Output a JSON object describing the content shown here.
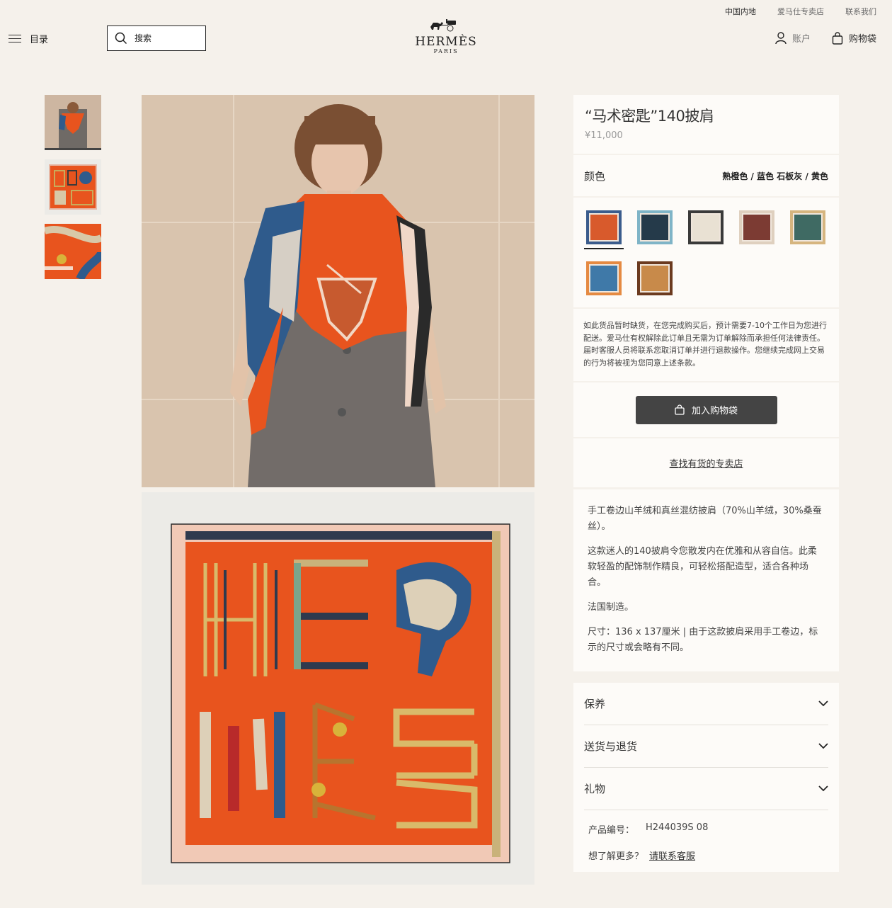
{
  "utility_bar": {
    "region": "中国内地",
    "stores": "爱马仕专卖店",
    "contact": "联系我们"
  },
  "header": {
    "menu_label": "目录",
    "search_placeholder": "搜索",
    "logo_text": "HERMÈS",
    "logo_sub": "PARIS",
    "account_label": "账户",
    "bag_label": "购物袋"
  },
  "gallery": {
    "thumbnails": [
      "model-wearing-scarf",
      "scarf-flat",
      "scarf-detail"
    ],
    "active_thumbnail": 0
  },
  "product": {
    "title": "“马术密匙”140披肩",
    "price": "¥11,000",
    "color_label": "颜色",
    "color_value": "熟橙色 / 蓝色 石板灰 / 黄色",
    "swatches": [
      {
        "bg": "#d85a2c",
        "accent": "#3b5c8c"
      },
      {
        "bg": "#253a4a",
        "accent": "#7fb4c7"
      },
      {
        "bg": "#e9e1d3",
        "accent": "#3a3a3a"
      },
      {
        "bg": "#7c3b33",
        "accent": "#dfd0bf"
      },
      {
        "bg": "#3f6a63",
        "accent": "#d6b57f"
      },
      {
        "bg": "#3f79a8",
        "accent": "#e58a42"
      },
      {
        "bg": "#c88a4a",
        "accent": "#6b3a1f"
      }
    ],
    "active_swatch": 0,
    "notice": "如此货品暂时缺货，在您完成购买后，预计需要7-10个工作日为您进行配送。爱马仕有权解除此订单且无需为订单解除而承担任何法律责任。届时客服人员将联系您取消订单并进行退款操作。您继续完成网上交易的行为将被视为您同意上述条款。",
    "cart_button": "加入购物袋",
    "find_store": "查找有货的专卖店",
    "description": [
      "手工卷边山羊绒和真丝混纺披肩（70%山羊绒，30%桑蚕丝）。",
      "这款迷人的140披肩令您散发内在优雅和从容自信。此柔软轻盈的配饰制作精良，可轻松搭配造型，适合各种场合。",
      "法国制造。",
      "尺寸：136 x 137厘米 | 由于这款披肩采用手工卷边，标示的尺寸或会略有不同。"
    ]
  },
  "accordion": {
    "care": "保养",
    "delivery": "送货与退货",
    "gift": "礼物"
  },
  "meta": {
    "sku_label": "产品编号：",
    "sku_value": "H244039S 08",
    "more_label": "想了解更多？",
    "contact_link": "请联系客服"
  },
  "colors": {
    "background": "#f5f1eb",
    "panel": "#fdfbf8",
    "button": "#444444",
    "scarf_orange": "#e8541e"
  }
}
